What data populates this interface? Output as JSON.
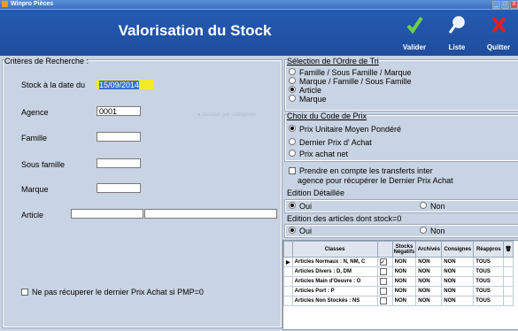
{
  "window": {
    "title": "Winpro Pièces",
    "min": "_",
    "max": "□",
    "close": "X"
  },
  "header": {
    "title": "Valorisation du Stock",
    "buttons": [
      {
        "label": "Valider",
        "icon": "checkmark-icon"
      },
      {
        "label": "Liste",
        "icon": "magnifier-icon"
      },
      {
        "label": "Quitter",
        "icon": "cross-icon"
      }
    ]
  },
  "criteria": {
    "group_title": "Critères de Recherche :",
    "stock_label": "Stock à la date du",
    "stock_date": "15/09/2014",
    "agence_label": "Agence",
    "agence_value": "0001",
    "famille_label": "Famille",
    "sous_famille_label": "Sous famille",
    "marque_label": "Marque",
    "article_label": "Article",
    "faded_hint": "Gestion par catégories",
    "no_pmp_label": "Ne pas récuperer le dernier Prix Achat si PMP=0"
  },
  "tri": {
    "title": "Sélection de l'Ordre de Tri",
    "options": [
      "Famille / Sous Famille / Marque",
      "Marque / Famille / Sous Famille",
      "Article",
      "Marque"
    ],
    "selected": 2
  },
  "prix": {
    "title": "Choix du Code de Prix",
    "options": [
      "Prix Unitaire Moyen Pondéré",
      "Dernier Prix d' Achat",
      "Prix achat net"
    ],
    "selected": 0
  },
  "transferts": {
    "label_line1": "Prendre en compte les transferts inter",
    "label_line2": "agence pour récupérer le Dernier Prix Achat"
  },
  "edition_detaillee": {
    "title": "Edition Détaillée",
    "oui": "Oui",
    "non": "Non"
  },
  "edition_sans_stock": {
    "title": "Edition des articles dont stock=0",
    "oui": "Oui",
    "non": "Non"
  },
  "table": {
    "headers": [
      "Classes",
      "Stocks Négatifs",
      "Archivés",
      "Consignes",
      "Réappros"
    ],
    "rows": [
      {
        "classe": "Articles Normaux : N, NM, C",
        "stocks": "NON",
        "archives": "NON",
        "consignes": "NON",
        "reappros": "TOUS",
        "checked": true
      },
      {
        "classe": "Articles Divers : D, DM",
        "stocks": "NON",
        "archives": "NON",
        "consignes": "NON",
        "reappros": "TOUS",
        "checked": false
      },
      {
        "classe": "Articles Main d'Oeuvre : O",
        "stocks": "NON",
        "archives": "NON",
        "consignes": "NON",
        "reappros": "TOUS",
        "checked": false
      },
      {
        "classe": "Articles Port : P",
        "stocks": "NON",
        "archives": "NON",
        "consignes": "NON",
        "reappros": "TOUS",
        "checked": false
      },
      {
        "classe": "Articles Non Stockés : NS",
        "stocks": "NON",
        "archives": "NON",
        "consignes": "NON",
        "reappros": "TOUS",
        "checked": false
      }
    ]
  }
}
